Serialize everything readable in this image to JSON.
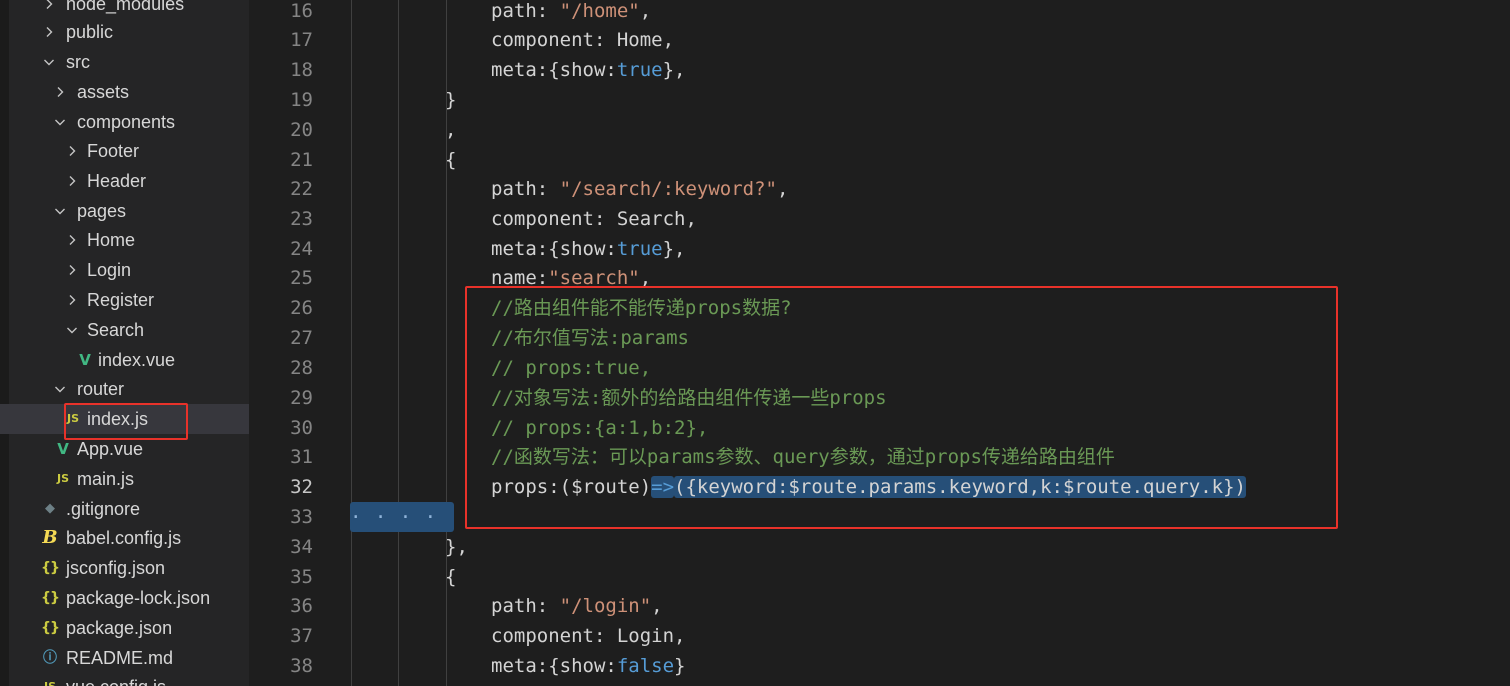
{
  "explorer": {
    "items": [
      {
        "label": "node_modules",
        "type": "folder",
        "expanded": false
      },
      {
        "label": "public",
        "type": "folder",
        "expanded": false
      },
      {
        "label": "src",
        "type": "folder",
        "expanded": true
      },
      {
        "label": "assets",
        "type": "folder",
        "expanded": false
      },
      {
        "label": "components",
        "type": "folder",
        "expanded": true
      },
      {
        "label": "Footer",
        "type": "folder",
        "expanded": false
      },
      {
        "label": "Header",
        "type": "folder",
        "expanded": false
      },
      {
        "label": "pages",
        "type": "folder",
        "expanded": true
      },
      {
        "label": "Home",
        "type": "folder",
        "expanded": false
      },
      {
        "label": "Login",
        "type": "folder",
        "expanded": false
      },
      {
        "label": "Register",
        "type": "folder",
        "expanded": false
      },
      {
        "label": "Search",
        "type": "folder",
        "expanded": true
      },
      {
        "label": "index.vue",
        "type": "file",
        "icon": "vue-icon",
        "icon_text": "V"
      },
      {
        "label": "router",
        "type": "folder",
        "expanded": true
      },
      {
        "label": "index.js",
        "type": "file",
        "icon": "js-icon",
        "icon_text": "JS",
        "selected": true
      },
      {
        "label": "App.vue",
        "type": "file",
        "icon": "vue-icon",
        "icon_text": "V"
      },
      {
        "label": "main.js",
        "type": "file",
        "icon": "js-icon",
        "icon_text": "JS"
      },
      {
        "label": ".gitignore",
        "type": "file",
        "icon": "git-icon",
        "icon_text": "◆"
      },
      {
        "label": "babel.config.js",
        "type": "file",
        "icon": "babel-icon",
        "icon_text": "B"
      },
      {
        "label": "jsconfig.json",
        "type": "file",
        "icon": "json-icon",
        "icon_text": "{}"
      },
      {
        "label": "package-lock.json",
        "type": "file",
        "icon": "json-icon",
        "icon_text": "{}"
      },
      {
        "label": "package.json",
        "type": "file",
        "icon": "json-icon",
        "icon_text": "{}"
      },
      {
        "label": "README.md",
        "type": "file",
        "icon": "info-icon",
        "icon_text": "ⓘ"
      },
      {
        "label": "vue.config.js",
        "type": "file",
        "icon": "js-icon",
        "icon_text": "JS"
      }
    ]
  },
  "editor": {
    "active_line": 32,
    "lines": [
      {
        "num": "16",
        "tokens": [
          {
            "t": "path: ",
            "c": "pl"
          },
          {
            "t": "\"/home\"",
            "c": "str"
          },
          {
            "t": ",",
            "c": "pl"
          }
        ]
      },
      {
        "num": "17",
        "tokens": [
          {
            "t": "component: Home,",
            "c": "pl"
          }
        ]
      },
      {
        "num": "18",
        "tokens": [
          {
            "t": "meta:{show:",
            "c": "pl"
          },
          {
            "t": "true",
            "c": "kw"
          },
          {
            "t": "},",
            "c": "pl"
          }
        ]
      },
      {
        "num": "19",
        "tokens": [
          {
            "t": "}",
            "c": "pl"
          }
        ]
      },
      {
        "num": "20",
        "tokens": [
          {
            "t": ",",
            "c": "pl"
          }
        ]
      },
      {
        "num": "21",
        "tokens": [
          {
            "t": "{",
            "c": "pl"
          }
        ]
      },
      {
        "num": "22",
        "tokens": [
          {
            "t": "path: ",
            "c": "pl"
          },
          {
            "t": "\"/search/:keyword?\"",
            "c": "str"
          },
          {
            "t": ",",
            "c": "pl"
          }
        ]
      },
      {
        "num": "23",
        "tokens": [
          {
            "t": "component: Search,",
            "c": "pl"
          }
        ]
      },
      {
        "num": "24",
        "tokens": [
          {
            "t": "meta:{show:",
            "c": "pl"
          },
          {
            "t": "true",
            "c": "kw"
          },
          {
            "t": "},",
            "c": "pl"
          }
        ]
      },
      {
        "num": "25",
        "tokens": [
          {
            "t": "name:",
            "c": "pl"
          },
          {
            "t": "\"search\"",
            "c": "str"
          },
          {
            "t": ",",
            "c": "pl"
          }
        ]
      },
      {
        "num": "26",
        "tokens": [
          {
            "t": "//路由组件能不能传递props数据?",
            "c": "cm"
          }
        ]
      },
      {
        "num": "27",
        "tokens": [
          {
            "t": "//布尔值写法:params",
            "c": "cm"
          }
        ]
      },
      {
        "num": "28",
        "tokens": [
          {
            "t": "// props:true,",
            "c": "cm"
          }
        ]
      },
      {
        "num": "29",
        "tokens": [
          {
            "t": "//对象写法:额外的给路由组件传递一些props",
            "c": "cm"
          }
        ]
      },
      {
        "num": "30",
        "tokens": [
          {
            "t": "// props:{a:1,b:2},",
            "c": "cm"
          }
        ]
      },
      {
        "num": "31",
        "tokens": [
          {
            "t": "//函数写法：可以params参数、query参数，通过props传递给路由组件",
            "c": "cm"
          }
        ]
      },
      {
        "num": "32",
        "tokens": [
          {
            "t": "props:($route)",
            "c": "pl"
          },
          {
            "t": "=>",
            "c": "kw",
            "sel": true
          },
          {
            "t": "({keyword:$route.params.keyword,k:$route.query.k})",
            "c": "pl",
            "sel": true
          }
        ]
      },
      {
        "num": "33",
        "tokens": []
      },
      {
        "num": "34",
        "tokens": [
          {
            "t": "},",
            "c": "pl"
          }
        ]
      },
      {
        "num": "35",
        "tokens": [
          {
            "t": "{",
            "c": "pl"
          }
        ]
      },
      {
        "num": "36",
        "tokens": [
          {
            "t": "path: ",
            "c": "pl"
          },
          {
            "t": "\"/login\"",
            "c": "str"
          },
          {
            "t": ",",
            "c": "pl"
          }
        ]
      },
      {
        "num": "37",
        "tokens": [
          {
            "t": "component: Login,",
            "c": "pl"
          }
        ]
      },
      {
        "num": "38",
        "tokens": [
          {
            "t": "meta:{show:",
            "c": "pl"
          },
          {
            "t": "false",
            "c": "kw"
          },
          {
            "t": "}",
            "c": "pl"
          }
        ]
      }
    ],
    "line33_selection_text": "· · · · · · · · · ·"
  }
}
